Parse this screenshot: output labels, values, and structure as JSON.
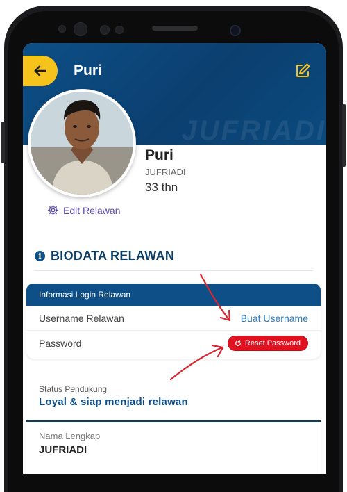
{
  "header": {
    "title": "Puri",
    "watermark": "JUFRIADI"
  },
  "profile": {
    "name": "Puri",
    "username": "JUFRIADI",
    "age": "33 thn",
    "edit_label": "Edit Relawan"
  },
  "biodata": {
    "section_title": "BIODATA RELAWAN",
    "login_card": {
      "title": "Informasi Login Relawan",
      "username_label": "Username Relawan",
      "username_action": "Buat Username",
      "password_label": "Password",
      "password_action": "Reset Password"
    },
    "status": {
      "label": "Status Pendukung",
      "value": "Loyal & siap menjadi relawan"
    },
    "full_name": {
      "label": "Nama Lengkap",
      "value": "JUFRIADI"
    }
  },
  "colors": {
    "primary": "#0d4f86",
    "accent_yellow": "#f6c21c",
    "danger": "#e1121f",
    "link": "#2a7bc0",
    "annotation_arrow": "#d9252f"
  },
  "icons": {
    "back": "arrow-left-icon",
    "edit": "edit-square-icon",
    "settings": "gear-icon",
    "info": "info-icon",
    "reset": "refresh-icon"
  }
}
